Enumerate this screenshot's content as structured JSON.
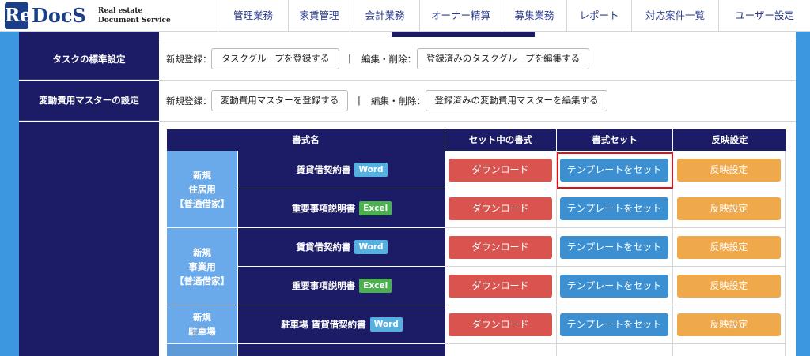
{
  "logo": {
    "badge": "Re",
    "word": "DocS",
    "sub1": "Real estate",
    "sub2": "Document Service"
  },
  "nav": [
    "管理業務",
    "家賃管理",
    "会計業務",
    "オーナー精算",
    "募集業務",
    "レポート",
    "対応案件一覧",
    "ユーザー設定"
  ],
  "settings": {
    "task": {
      "label": "タスクの標準設定",
      "new_label": "新規登録：",
      "new_button": "タスクグループを登録する",
      "separator": "|",
      "edit_label": "編集・削除：",
      "edit_button": "登録済みのタスクグループを編集する"
    },
    "cost": {
      "label": "変動費用マスターの設定",
      "new_label": "新規登録：",
      "new_button": "変動費用マスターを登録する",
      "separator": "|",
      "edit_label": "編集・削除：",
      "edit_button": "登録済みの変動費用マスターを編集する"
    }
  },
  "table": {
    "headers": [
      "書式名",
      "セット中の書式",
      "書式セット",
      "反映設定"
    ],
    "categories": [
      {
        "lines": [
          "新規",
          "住居用",
          "【普通借家】"
        ]
      },
      {
        "lines": [
          "新規",
          "事業用",
          "【普通借家】"
        ]
      },
      {
        "lines": [
          "新規",
          "駐車場"
        ]
      }
    ],
    "rows": [
      {
        "name": "賃貸借契約書",
        "badge": "Word"
      },
      {
        "name": "重要事項説明書",
        "badge": "Excel"
      },
      {
        "name": "賃貸借契約書",
        "badge": "Word"
      },
      {
        "name": "重要事項説明書",
        "badge": "Excel"
      },
      {
        "name": "駐車場 賃貸借契約書",
        "badge": "Word"
      }
    ],
    "download_label": "ダウンロード",
    "template_label": "テンプレートをセット",
    "reflect_label": "反映設定"
  },
  "colors": {
    "navy": "#1b1b66",
    "frame_blue": "#3d96e0",
    "category_blue": "#6aa9ea",
    "download_red": "#d9534f",
    "template_blue": "#3c8fd0",
    "reflect_orange": "#efa84a",
    "word_badge": "#55b0e0",
    "excel_badge": "#4caf50",
    "highlight_red": "#e0101a"
  }
}
